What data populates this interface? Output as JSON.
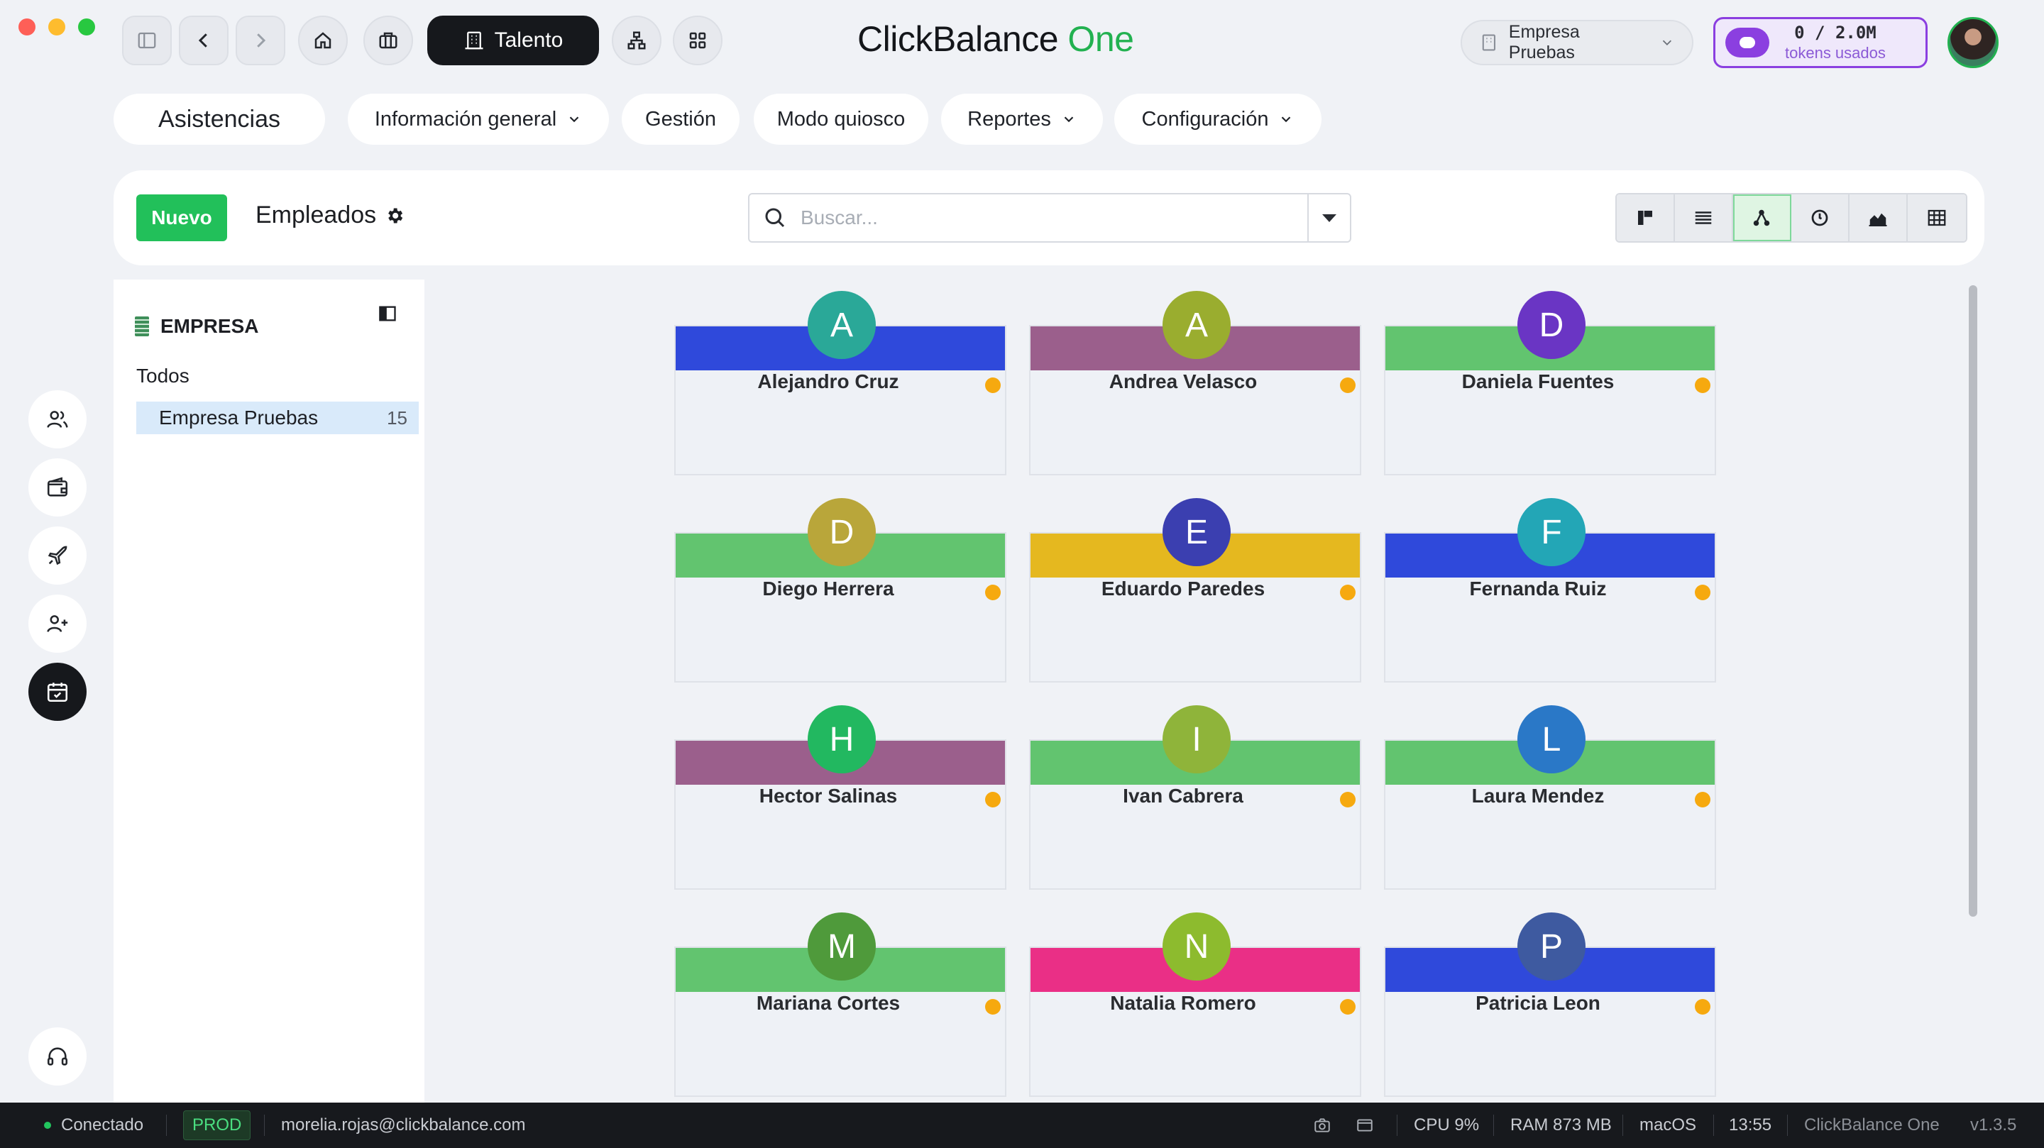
{
  "app": {
    "brand_main": "ClickBalance",
    "brand_accent": "One",
    "module_label": "Talento",
    "company_selector": "Empresa Pruebas",
    "tokens_count": "0 / 2.0M",
    "tokens_label": "tokens usados"
  },
  "menu": {
    "title": "Asistencias",
    "items": [
      "Información general",
      "Gestión",
      "Modo quiosco",
      "Reportes",
      "Configuración"
    ]
  },
  "toolbar": {
    "new_label": "Nuevo",
    "title": "Empleados",
    "search_placeholder": "Buscar..."
  },
  "sidebar": {
    "header": "EMPRESA",
    "all_label": "Todos",
    "selected_company": "Empresa Pruebas",
    "selected_count": "15"
  },
  "employees": [
    {
      "initial": "A",
      "name": "Alejandro Cruz",
      "band_color": "#2f49db",
      "avatar_color": "#2aa898",
      "status_color": "#f6a90f"
    },
    {
      "initial": "A",
      "name": "Andrea Velasco",
      "band_color": "#9b5f8c",
      "avatar_color": "#9aad2f",
      "status_color": "#f6a90f"
    },
    {
      "initial": "D",
      "name": "Daniela Fuentes",
      "band_color": "#62c46f",
      "avatar_color": "#6a35c4",
      "status_color": "#f6a90f"
    },
    {
      "initial": "D",
      "name": "Diego Herrera",
      "band_color": "#62c46f",
      "avatar_color": "#b9a63a",
      "status_color": "#f6a90f"
    },
    {
      "initial": "E",
      "name": "Eduardo Paredes",
      "band_color": "#e5b81f",
      "avatar_color": "#3b3fb0",
      "status_color": "#f6a90f"
    },
    {
      "initial": "F",
      "name": "Fernanda Ruiz",
      "band_color": "#2f49db",
      "avatar_color": "#23a6b6",
      "status_color": "#f6a90f"
    },
    {
      "initial": "H",
      "name": "Hector Salinas",
      "band_color": "#9b5f8c",
      "avatar_color": "#22b860",
      "status_color": "#f6a90f"
    },
    {
      "initial": "I",
      "name": "Ivan Cabrera",
      "band_color": "#62c46f",
      "avatar_color": "#8fb43a",
      "status_color": "#f6a90f"
    },
    {
      "initial": "L",
      "name": "Laura Mendez",
      "band_color": "#62c46f",
      "avatar_color": "#2a78c7",
      "status_color": "#f6a90f"
    },
    {
      "initial": "M",
      "name": "Mariana Cortes",
      "band_color": "#62c46f",
      "avatar_color": "#4f9a3b",
      "status_color": "#f6a90f"
    },
    {
      "initial": "N",
      "name": "Natalia Romero",
      "band_color": "#ea2f86",
      "avatar_color": "#8dbb2e",
      "status_color": "#f6a90f"
    },
    {
      "initial": "P",
      "name": "Patricia Leon",
      "band_color": "#2f49db",
      "avatar_color": "#3e5aa0",
      "status_color": "#f6a90f"
    }
  ],
  "status_bar": {
    "connection": "Conectado",
    "env": "PROD",
    "user_email": "morelia.rojas@clickbalance.com",
    "cpu": "CPU 9%",
    "ram": "RAM 873 MB",
    "os": "macOS",
    "time": "13:55",
    "app_name": "ClickBalance One",
    "version": "v1.3.5"
  },
  "colors": {
    "accent_green": "#22c05a",
    "brand_one": "#22b150",
    "tokens_purple": "#8b3fe0",
    "status_dot": "#f6a90f"
  }
}
